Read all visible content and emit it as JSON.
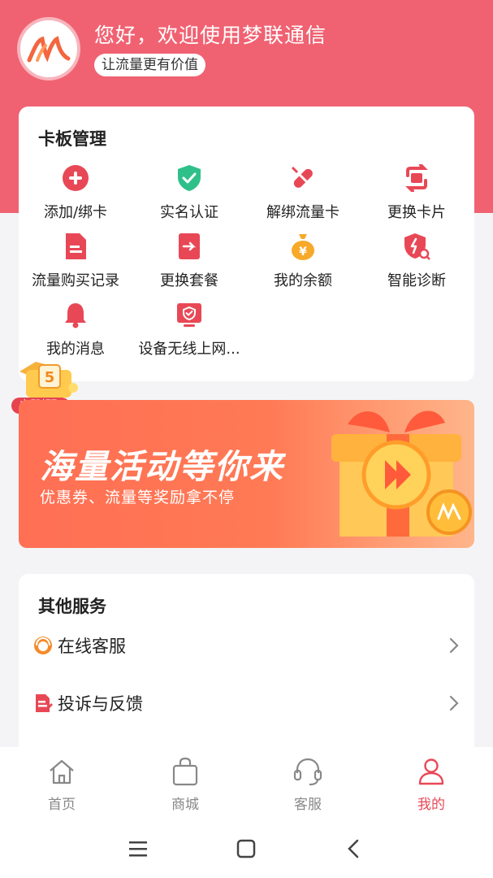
{
  "header": {
    "greeting": "您好，欢迎使用梦联通信",
    "slogan": "让流量更有价值"
  },
  "card_management": {
    "title": "卡板管理",
    "items": [
      {
        "label": "添加/绑卡",
        "icon": "add-circle-icon"
      },
      {
        "label": "实名认证",
        "icon": "shield-check-icon"
      },
      {
        "label": "解绑流量卡",
        "icon": "unbind-pill-icon"
      },
      {
        "label": "更换卡片",
        "icon": "swap-card-icon"
      },
      {
        "label": "流量购买记录",
        "icon": "document-icon"
      },
      {
        "label": "更换套餐",
        "icon": "change-plan-icon"
      },
      {
        "label": "我的余额",
        "icon": "money-bag-icon"
      },
      {
        "label": "智能诊断",
        "icon": "diagnose-shield-icon"
      },
      {
        "label": "我的消息",
        "icon": "bell-icon"
      },
      {
        "label": "设备无线上网...",
        "icon": "wireless-device-icon"
      }
    ]
  },
  "coupon_badge": {
    "label": "立即领取",
    "number": "5"
  },
  "banner": {
    "title": "海量活动等你来",
    "subtitle": "优惠券、流量等奖励拿不停"
  },
  "other_services": {
    "title": "其他服务",
    "items": [
      {
        "label": "在线客服",
        "icon": "customer-service-icon"
      },
      {
        "label": "投诉与反馈",
        "icon": "feedback-icon"
      }
    ]
  },
  "tabbar": {
    "tabs": [
      {
        "label": "首页",
        "icon": "home-icon",
        "active": false
      },
      {
        "label": "商城",
        "icon": "shopping-bag-icon",
        "active": false
      },
      {
        "label": "客服",
        "icon": "headset-icon",
        "active": false
      },
      {
        "label": "我的",
        "icon": "user-icon",
        "active": true
      }
    ]
  },
  "colors": {
    "brand": "#f06272",
    "accent_red": "#e84856",
    "icon_green": "#2fc08a",
    "icon_orange": "#f7a928"
  }
}
